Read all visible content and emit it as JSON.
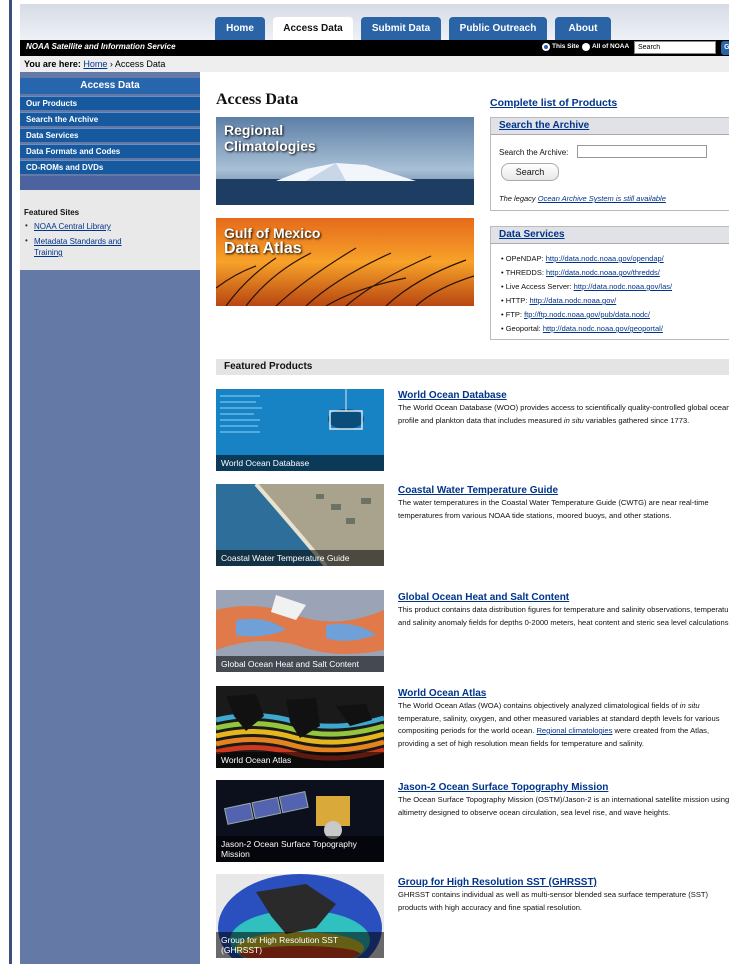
{
  "nav": {
    "tabs": [
      {
        "label": "Home"
      },
      {
        "label": "Access Data",
        "active": true
      },
      {
        "label": "Submit Data"
      },
      {
        "label": "Public Outreach"
      },
      {
        "label": "About"
      }
    ],
    "service_title": "NOAA Satellite and Information Service",
    "scope_this_site": "This Site",
    "scope_all_noaa": "All of NOAA",
    "search_value": "Search",
    "go_label": "Go"
  },
  "breadcrumb": {
    "prefix": "You are here:",
    "home": "Home",
    "sep": "›",
    "current": "Access Data"
  },
  "sidebar": {
    "heading": "Access Data",
    "items": [
      {
        "label": "Our Products"
      },
      {
        "label": "Search the Archive"
      },
      {
        "label": "Data Services"
      },
      {
        "label": "Data Formats and Codes"
      },
      {
        "label": "CD-ROMs and DVDs"
      }
    ],
    "featured_sites_title": "Featured Sites",
    "featured_sites": [
      {
        "label": "NOAA Central Library"
      },
      {
        "label_line1": "Metadata Standards and",
        "label_line2": "Training"
      }
    ]
  },
  "main": {
    "title": "Access Data",
    "banners": [
      {
        "line1": "Regional",
        "line2": "Climatologies"
      },
      {
        "line1": "Gulf of Mexico",
        "line2": "Data Atlas"
      }
    ],
    "complete_list_link": "Complete list of Products",
    "search_archive": {
      "heading": "Search the Archive",
      "label": "Search the Archive:",
      "button": "Search",
      "legacy_prefix": "The legacy ",
      "legacy_link": "Ocean Archive System is still available"
    },
    "data_services": {
      "heading": "Data Services",
      "items": [
        {
          "label": "OPeNDAP: ",
          "url": "http://data.nodc.noaa.gov/opendap/"
        },
        {
          "label": "THREDDS: ",
          "url": "http://data.nodc.noaa.gov/thredds/"
        },
        {
          "label": "Live Access Server: ",
          "url": "http://data.nodc.noaa.gov/las/"
        },
        {
          "label": "HTTP: ",
          "url": "http://data.nodc.noaa.gov/"
        },
        {
          "label": "FTP: ",
          "url": "ftp://ftp.nodc.noaa.gov/pub/data.nodc/"
        },
        {
          "label": "Geoportal: ",
          "url": "http://data.nodc.noaa.gov/geoportal/"
        }
      ]
    },
    "featured_products_heading": "Featured Products",
    "products": [
      {
        "title": "World Ocean Database",
        "caption": "World Ocean Database",
        "desc_a": "The World Ocean Database (WOO) provides access to scientifically quality-controlled global ocean profile and plankton data that includes measured ",
        "desc_em": "in situ",
        "desc_b": " variables gathered since 1773."
      },
      {
        "title": "Coastal Water Temperature Guide",
        "caption": "Coastal Water Temperature Guide",
        "desc": "The water temperatures in the Coastal Water Temperature Guide (CWTG) are near real-time temperatures from various NOAA tide stations, moored buoys, and other stations."
      },
      {
        "title": "Global Ocean Heat and Salt Content",
        "caption": "Global Ocean Heat and Salt Content",
        "desc": "This product contains data distribution figures for temperature and salinity observations, temperature and salinity anomaly fields for depths 0-2000 meters, heat content and steric sea level calculations."
      },
      {
        "title": "World Ocean Atlas",
        "caption": "World Ocean Atlas",
        "desc_a": "The World Ocean Atlas (WOA) contains objectively analyzed climatological fields of ",
        "desc_em": "in situ",
        "desc_b": " temperature, salinity, oxygen, and other measured variables at standard depth levels for various compositing periods for the world ocean. ",
        "desc_link": "Regional climatologies",
        "desc_c": " were created from the Atlas, providing a set of high resolution mean fields for temperature and salinity."
      },
      {
        "title": "Jason-2 Ocean Surface Topography Mission",
        "caption": "Jason-2 Ocean Surface Topography Mission",
        "desc": "The Ocean Surface Topography Mission (OSTM)/Jason-2 is an international satellite mission using altimetry designed to observe ocean circulation, sea level rise, and wave heights."
      },
      {
        "title": "Group for High Resolution SST (GHRSST)",
        "caption": "Group for High Resolution SST (GHRSST)",
        "desc": "GHRSST contains individual as well as multi-sensor blended sea surface temperature (SST) products with high accuracy and fine spatial resolution."
      }
    ]
  },
  "colors": {
    "nav_blue": "#2a63a6",
    "link": "#00348b",
    "sidebar": "#6579a6"
  }
}
